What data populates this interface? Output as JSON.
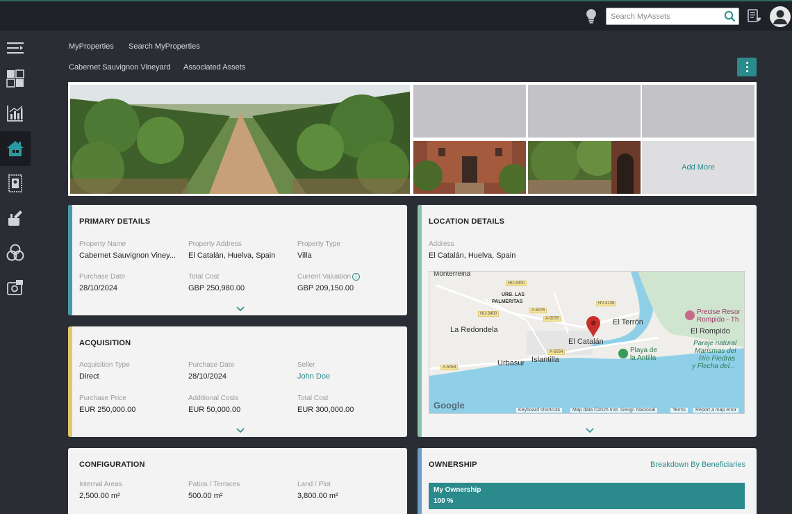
{
  "topbar": {
    "search_placeholder": "Search MyAssets"
  },
  "sidebar": {
    "items": [
      "menu-toggle",
      "dashboard",
      "analytics",
      "properties",
      "documents",
      "tools",
      "network",
      "archive"
    ],
    "active": "properties"
  },
  "breadcrumb": {
    "row1": [
      "MyProperties",
      "Search MyProperties"
    ],
    "row2": [
      "Cabernet Sauvignon Vineyard",
      "Associated Assets"
    ]
  },
  "gallery": {
    "add_more": "Add More"
  },
  "primary": {
    "title": "PRIMARY DETAILS",
    "fields": [
      {
        "label": "Property Name",
        "value": "Cabernet Sauvignon Viney..."
      },
      {
        "label": "Property Address",
        "value": "El Catalán, Huelva, Spain"
      },
      {
        "label": "Property Type",
        "value": "Villa"
      },
      {
        "label": "Purchase Date",
        "value": "28/10/2024"
      },
      {
        "label": "Total Cost",
        "value": "GBP 250,980.00"
      },
      {
        "label": "Current Valuation",
        "value": "GBP 209,150.00"
      }
    ]
  },
  "acquisition": {
    "title": "ACQUISITION",
    "fields": [
      {
        "label": "Acquisition Type",
        "value": "Direct"
      },
      {
        "label": "Purchase Date",
        "value": "28/10/2024"
      },
      {
        "label": "Seller",
        "value": "John Doe"
      },
      {
        "label": "Purchase Price",
        "value": "EUR 250,000.00"
      },
      {
        "label": "Additional Costs",
        "value": "EUR 50,000.00"
      },
      {
        "label": "Total Cost",
        "value": "EUR 300,000.00"
      }
    ]
  },
  "configuration": {
    "title": "CONFIGURATION",
    "fields": [
      {
        "label": "Internal Areas",
        "value": "2,500.00 m²"
      },
      {
        "label": "Patios / Terraces",
        "value": "500.00 m²"
      },
      {
        "label": "Land / Plot",
        "value": "3,800.00 m²"
      }
    ]
  },
  "location": {
    "title": "LOCATION DETAILS",
    "address_label": "Address",
    "address_value": "El Catalán, Huelva, Spain",
    "map": {
      "places": [
        "Monterreina",
        "URB. LAS",
        "PALMERITAS",
        "La Redondela",
        "Urbasur",
        "Islantilla",
        "El Catalán",
        "El Terrón",
        "El Rompido",
        "Precise Resor",
        "Rompido - Th",
        "Playa de",
        "la Antilla",
        "Paraje natural",
        "Marismas del",
        "Río Piedras",
        "y Flecha del..."
      ],
      "roads": [
        "HU-3400",
        "HU-3400",
        "A-5076",
        "A-5076",
        "HV-4126",
        "A-5054",
        "A-5054"
      ],
      "google": "Google",
      "footer": [
        "Keyboard shortcuts",
        "Map data ©2025 Inst. Geogr. Nacional",
        "Terms",
        "Report a map error"
      ]
    }
  },
  "ownership": {
    "title": "OWNERSHIP",
    "breakdown_link": "Breakdown By Beneficiaries",
    "mine_label": "My Ownership",
    "mine_value": "100 %"
  },
  "colors": {
    "accent": "#2a8a8c",
    "primary_bar": "#4a9aa8",
    "acquisition_bar": "#e2c66a",
    "location_bar": "#8ac4b0",
    "ownership_bar": "#6a9ec8"
  }
}
